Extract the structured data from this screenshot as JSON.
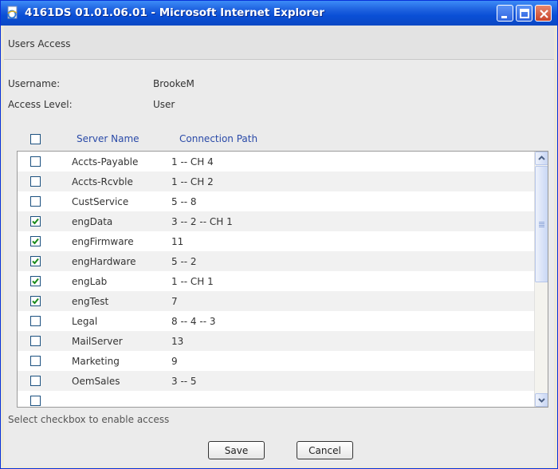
{
  "window": {
    "title": "4161DS 01.01.06.01 - Microsoft Internet Explorer"
  },
  "section": {
    "title": "Users Access"
  },
  "user_info": {
    "username_label": "Username:",
    "username": "BrookeM",
    "access_level_label": "Access Level:",
    "access_level": "User"
  },
  "table": {
    "header_server": "Server Name",
    "header_path": "Connection Path",
    "select_all_checked": false,
    "rows": [
      {
        "name": "Accts-Payable",
        "path": "1 -- CH 4",
        "checked": false
      },
      {
        "name": "Accts-Rcvble",
        "path": "1 -- CH 2",
        "checked": false
      },
      {
        "name": "CustService",
        "path": "5 -- 8",
        "checked": false
      },
      {
        "name": "engData",
        "path": "3 -- 2 -- CH 1",
        "checked": true
      },
      {
        "name": "engFirmware",
        "path": "11",
        "checked": true
      },
      {
        "name": "engHardware",
        "path": "5 -- 2",
        "checked": true
      },
      {
        "name": "engLab",
        "path": "1 -- CH 1",
        "checked": true
      },
      {
        "name": "engTest",
        "path": "7",
        "checked": true
      },
      {
        "name": "Legal",
        "path": "8 -- 4 -- 3",
        "checked": false
      },
      {
        "name": "MailServer",
        "path": "13",
        "checked": false
      },
      {
        "name": "Marketing",
        "path": "9",
        "checked": false
      },
      {
        "name": "OemSales",
        "path": "3 -- 5",
        "checked": false
      },
      {
        "name": "",
        "path": "",
        "checked": false
      }
    ]
  },
  "hint": "Select checkbox to enable access",
  "buttons": {
    "save": "Save",
    "cancel": "Cancel"
  },
  "icons": {
    "title": "ie-page-icon",
    "minimize": "minimize-icon",
    "maximize": "maximize-icon",
    "close": "close-icon",
    "scroll_up": "chevron-up-icon",
    "scroll_down": "chevron-down-icon",
    "check": "check-icon"
  },
  "colors": {
    "titlebar": "#0a4fd6",
    "close_button": "#c9442a",
    "header_text": "#2a4aa8",
    "check": "#1a8a1a"
  }
}
